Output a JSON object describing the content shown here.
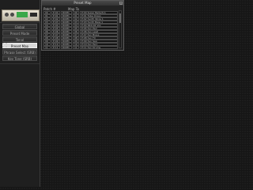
{
  "sidebar": {
    "items": [
      {
        "label": "Global"
      },
      {
        "label": "Preset Mode"
      },
      {
        "label": "Tonal"
      },
      {
        "label": "Preset Map"
      },
      {
        "label": "Phrase Select (SRB)"
      },
      {
        "label": "Key Tone (SRB)"
      }
    ],
    "active_index": 3
  },
  "window": {
    "title": "Preset Map",
    "col1": "Patch #",
    "col2": "Map To",
    "rows": [
      {
        "n": "00",
        "p": "P:04",
        "b": "ROM1",
        "num": "00",
        "name": "P:00 Super Bells/Arp"
      },
      {
        "n": "01",
        "p": "P:01",
        "b": "ROM1",
        "num": "01",
        "name": "P:01 Tube Organ"
      },
      {
        "n": "02",
        "p": "P:02",
        "b": "ROM1",
        "num": "02",
        "name": "P:02 Synth Strgs 1"
      },
      {
        "n": "03",
        "p": "P:03",
        "b": "ROM1",
        "num": "03",
        "name": "P:03 Synth Bass 1"
      },
      {
        "n": "04",
        "p": "P:04",
        "b": "ROM1",
        "num": "04",
        "name": "P:04 SRX-04 Vox"
      },
      {
        "n": "05",
        "p": "P:05",
        "b": "ROM1",
        "num": "05",
        "name": "P:05 Syn Pad"
      },
      {
        "n": "06",
        "p": "P:06",
        "b": "ROM1",
        "num": "06",
        "name": "P:06 Syn Lead"
      },
      {
        "n": "07",
        "p": "P:07",
        "b": "ROM1",
        "num": "07",
        "name": "P:07 Syn Brass"
      },
      {
        "n": "08",
        "p": "P:08",
        "b": "ROM1",
        "num": "08",
        "name": "P:08 Syn FX"
      },
      {
        "n": "09",
        "p": "P:09",
        "b": "ROM1",
        "num": "09",
        "name": "P:09 Syn Seq"
      },
      {
        "n": "10",
        "p": "P:10",
        "b": "ROM1",
        "num": "10",
        "name": "P:10 Syn Perc"
      },
      {
        "n": "11",
        "p": "P:11",
        "b": "ROM1",
        "num": "11",
        "name": "P:11 Syn Drums"
      }
    ]
  }
}
